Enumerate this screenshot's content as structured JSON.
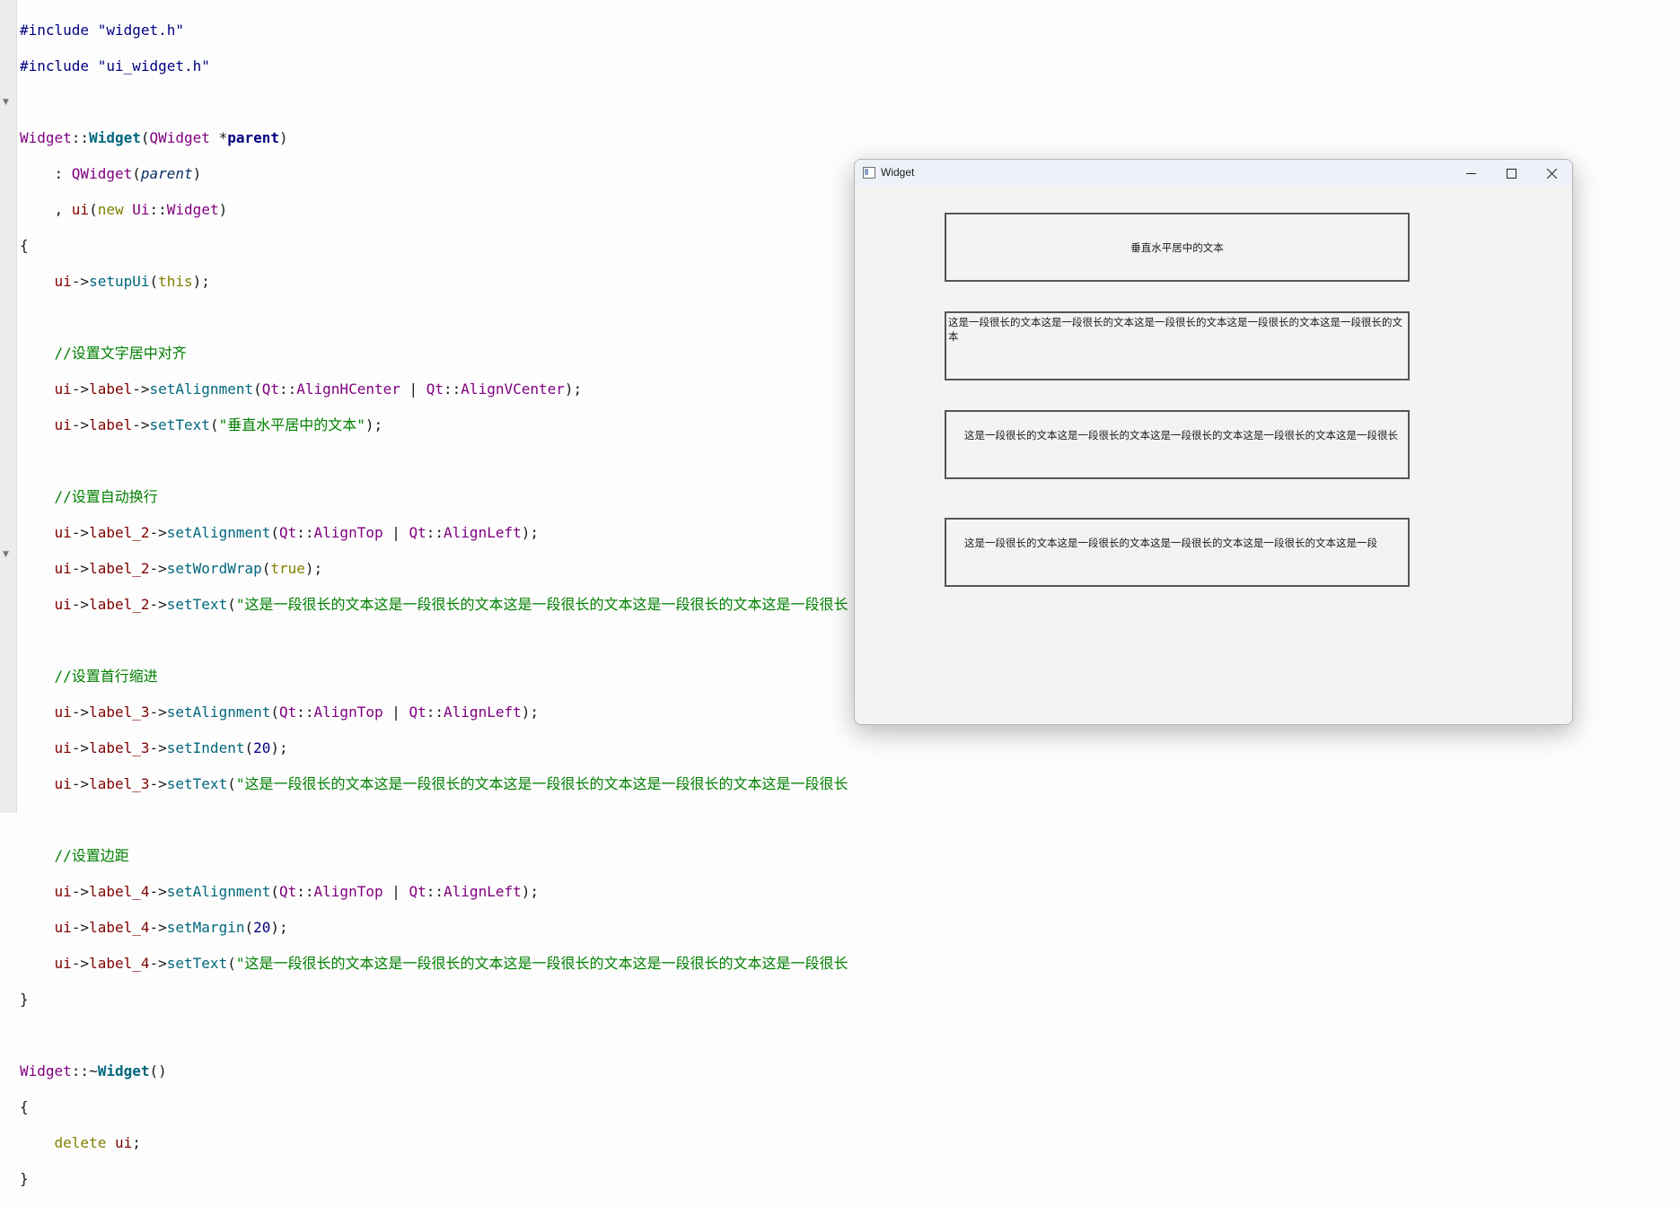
{
  "editor": {
    "lines": {
      "l1": "#include \"widget.h\"",
      "l2": "#include \"ui_widget.h\"",
      "c1": "//设置文字居中对齐",
      "t1": "\"垂直水平居中的文本\"",
      "c2": "//设置自动换行",
      "t2": "\"这是一段很长的文本这是一段很长的文本这是一段很长的文本这是一段很长的文本这是一段很长",
      "c3": "//设置首行缩进",
      "c4": "//设置边距"
    }
  },
  "window": {
    "title": "Widget",
    "label1": "垂直水平居中的文本",
    "label2": "这是一段很长的文本这是一段很长的文本这是一段很长的文本这是一段很长的文本这是一段很长的文本",
    "label3": "这是一段很长的文本这是一段很长的文本这是一段很长的文本这是一段很长的文本这是一段很长",
    "label4": "这是一段很长的文本这是一段很长的文本这是一段很长的文本这是一段很长的文本这是一段"
  }
}
